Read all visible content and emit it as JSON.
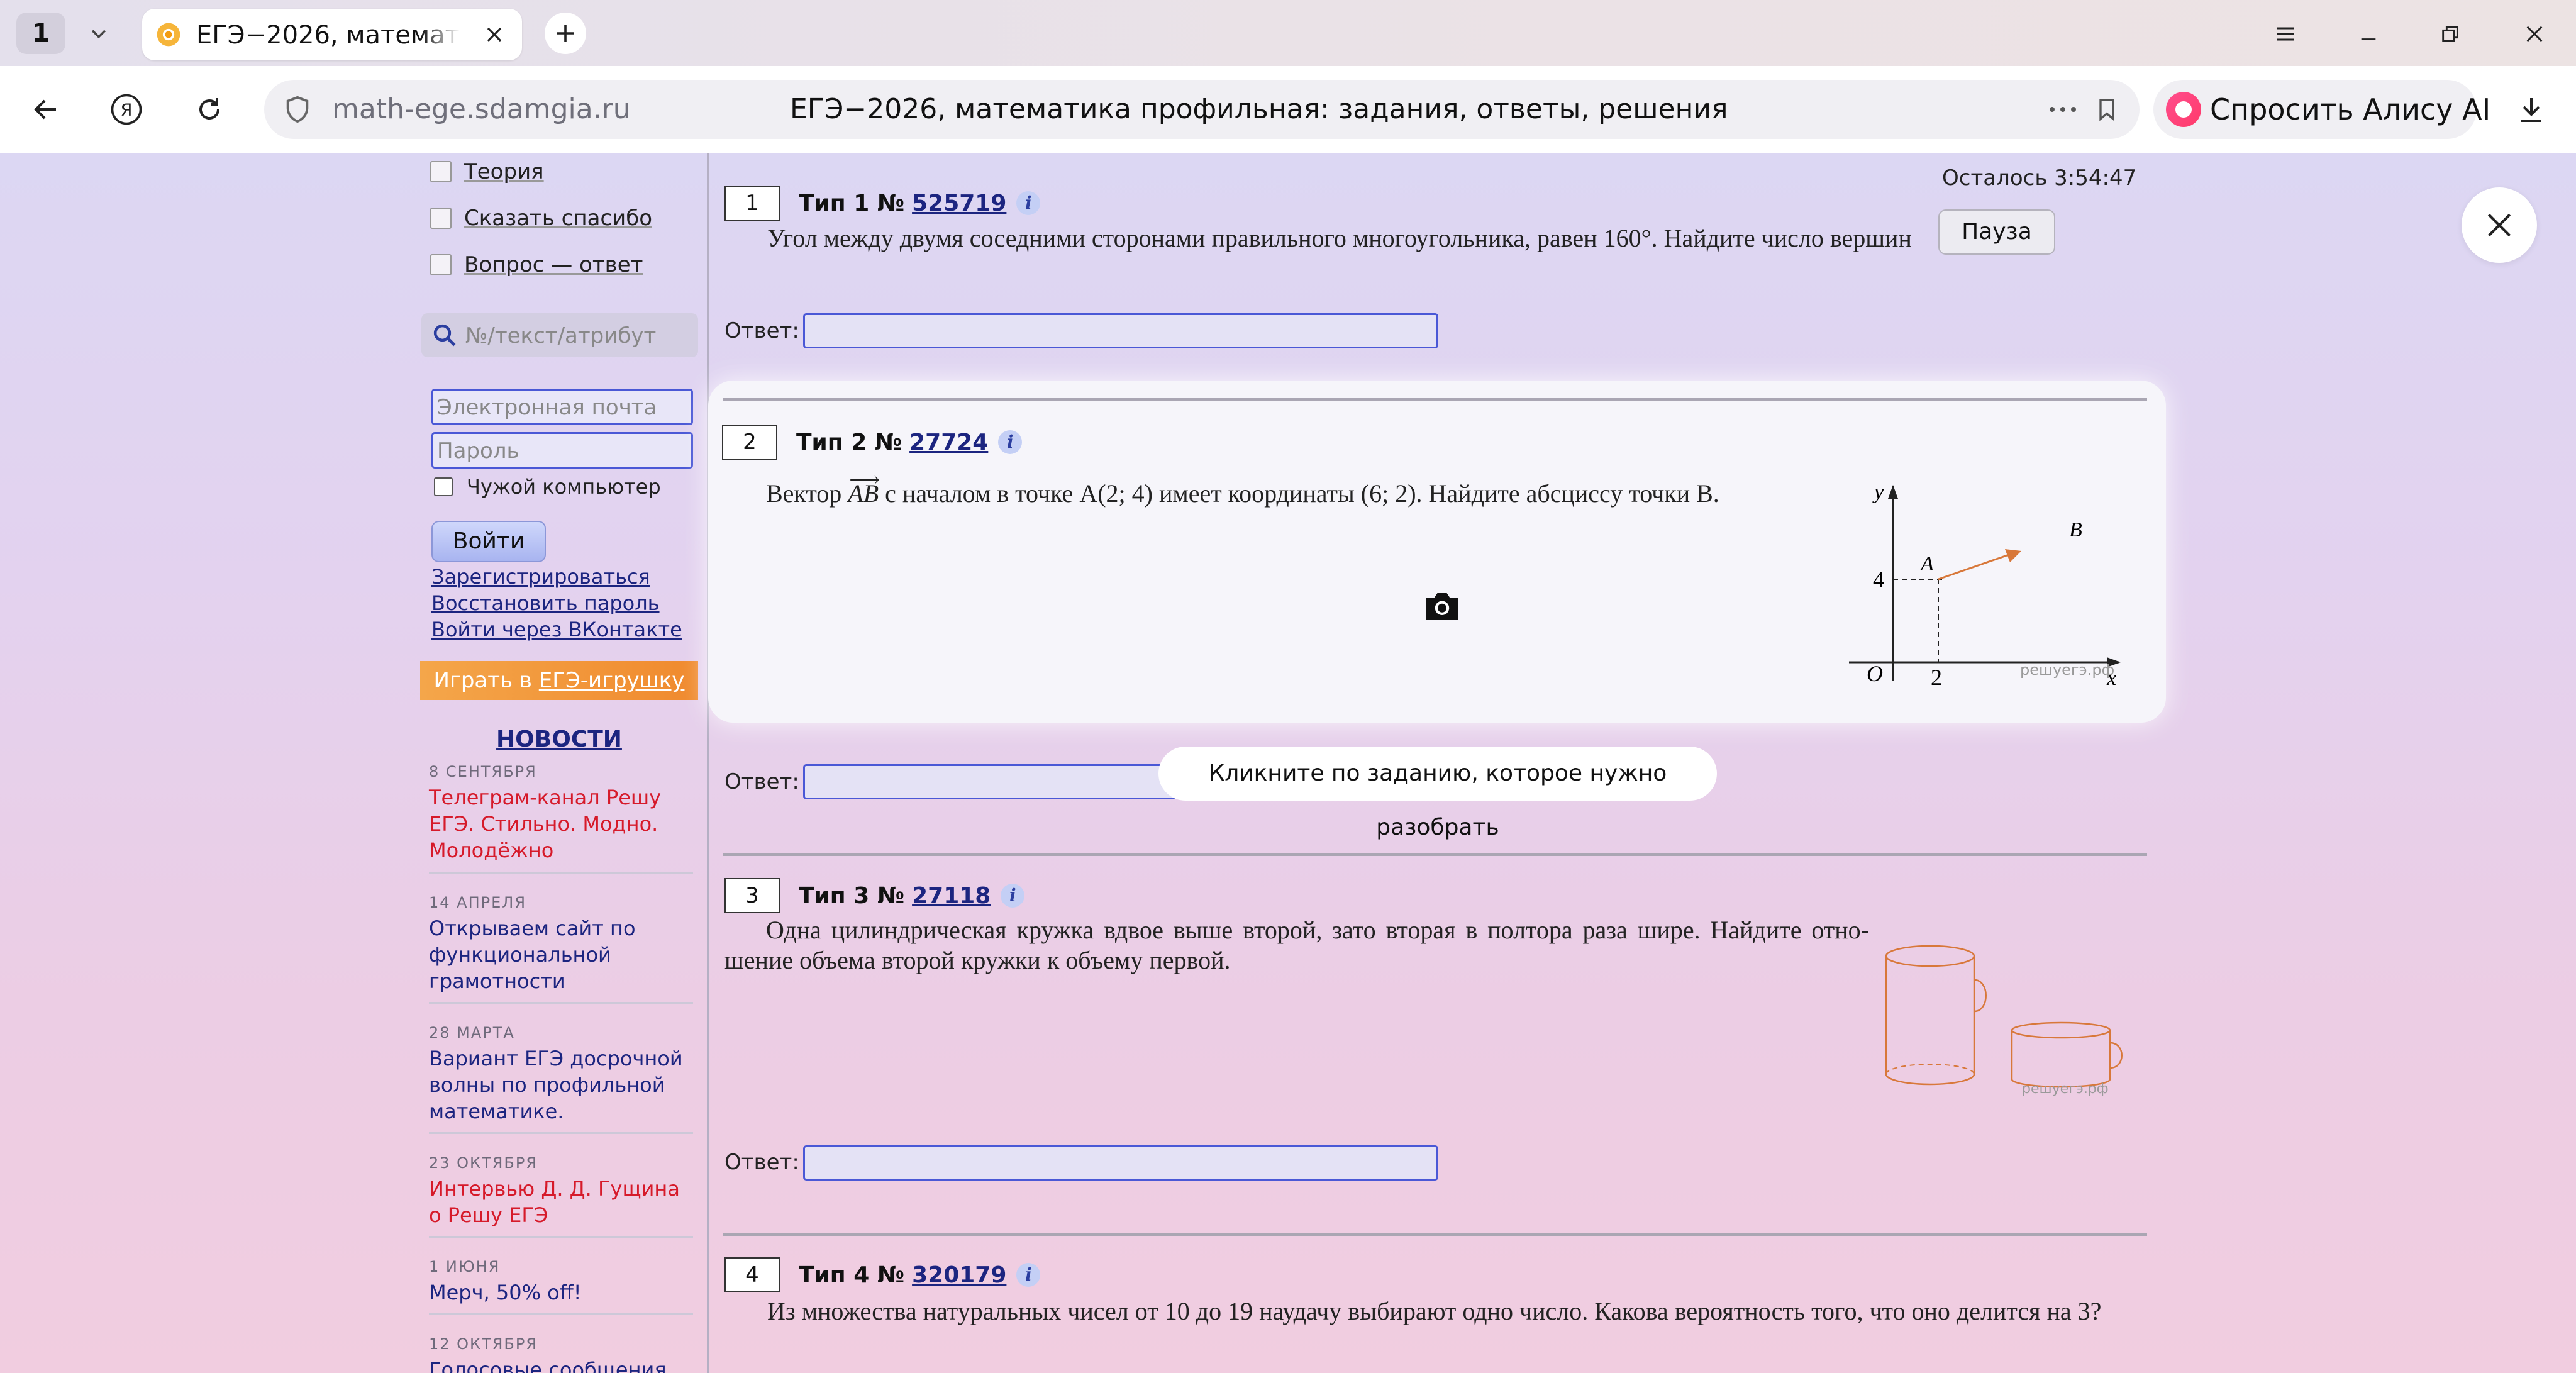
{
  "browser": {
    "tab_count": "1",
    "tab_title": "ЕГЭ−2026, математика профильная: задания, ответы, решения",
    "url_domain": "math-ege.sdamgia.ru",
    "page_title": "ЕГЭ−2026, математика профильная: задания, ответы, решения",
    "alice_label": "Спросить Алису AI"
  },
  "sidebar": {
    "menu": [
      "Теория",
      "Сказать спасибо",
      "Вопрос — ответ"
    ],
    "search_placeholder": "№/текст/атрибут",
    "email_placeholder": "Электронная почта",
    "password_placeholder": "Пароль",
    "foreign_pc": "Чужой компьютер",
    "login_button": "Войти",
    "links": [
      "Зарегистрироваться",
      "Восстановить пароль",
      "Войти через ВКонтакте"
    ],
    "game_prefix": "Играть в",
    "game_link": "ЕГЭ-игрушку",
    "news_header": "НОВОСТИ",
    "news": [
      {
        "date": "8 СЕНТЯБРЯ",
        "text": "Телеграм-канал Решу ЕГЭ. Стильно. Модно. Молодёжно"
      },
      {
        "date": "14 АПРЕЛЯ",
        "text": "Открываем сайт по функциональной грамотности"
      },
      {
        "date": "28 МАРТА",
        "text": "Вариант ЕГЭ досрочной волны по профильной математике."
      },
      {
        "date": "23 ОКТЯБРЯ",
        "text": "Интервью Д. Д. Гущина о Решу ЕГЭ"
      },
      {
        "date": "1 ИЮНЯ",
        "text": "Мерч, 50% off!"
      },
      {
        "date": "12 ОКТЯБРЯ",
        "text": "Голосовые сообщения на"
      }
    ]
  },
  "main": {
    "timer": "Осталось 3:54:47",
    "pause_button": "Пауза",
    "answer_label": "Ответ:",
    "hint": "Кликните по заданию, которое нужно разобрать",
    "tasks": [
      {
        "num": "1",
        "type": "Тип 1 №",
        "id": "525719",
        "text": "Угол между двумя соседними сторонами правильного многоугольника, равен 160°. Найдите число вершин"
      },
      {
        "num": "2",
        "type": "Тип 2 №",
        "id": "27724",
        "text_before": "Вектор",
        "vector": "AB",
        "text_after": "с началом в точке A(2; 4) имеет координаты (6; 2). Найдите абсциссу точки B."
      },
      {
        "num": "3",
        "type": "Тип 3 №",
        "id": "27118",
        "text": "Одна цилиндрическая кружка вдвое выше второй, зато вторая в полтора раза шире. Найдите отно-шение объема второй кружки к объему первой."
      },
      {
        "num": "4",
        "type": "Тип 4 №",
        "id": "320179",
        "text": "Из множества натуральных чисел от 10 до 19 наудачу выбирают одно число. Какова вероятность того, что оно делится на 3?"
      }
    ],
    "figure2": {
      "y": "y",
      "x": "x",
      "o": "O",
      "four": "4",
      "two": "2",
      "a": "A",
      "b": "B",
      "watermark": "решуегэ.рф"
    },
    "figure3": {
      "watermark": "решуегэ.рф"
    }
  },
  "colors": {
    "link": "#1c2580",
    "accent_red": "#d61a2a",
    "input_border": "#4a58d6",
    "figure_orange": "#d8783a"
  }
}
